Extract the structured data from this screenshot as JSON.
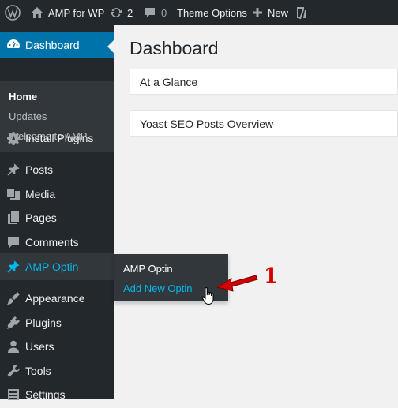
{
  "adminbar": {
    "site_name": "AMP for WP",
    "updates_count": "2",
    "comments_count": "0",
    "theme_options": "Theme Options",
    "new_label": "New"
  },
  "sidebar": {
    "dashboard": "Dashboard",
    "submenu": [
      "Home",
      "Updates",
      "Welcome to AMP"
    ],
    "items": [
      {
        "label": "Install Plugins",
        "icon": "gear-icon"
      },
      {
        "label": "Posts",
        "icon": "pin-icon"
      },
      {
        "label": "Media",
        "icon": "media-icon"
      },
      {
        "label": "Pages",
        "icon": "pages-icon"
      },
      {
        "label": "Comments",
        "icon": "comment-icon"
      },
      {
        "label": "AMP Optin",
        "icon": "pin-icon"
      },
      {
        "label": "Appearance",
        "icon": "brush-icon"
      },
      {
        "label": "Plugins",
        "icon": "plugin-icon"
      },
      {
        "label": "Users",
        "icon": "user-icon"
      },
      {
        "label": "Tools",
        "icon": "wrench-icon"
      },
      {
        "label": "Settings",
        "icon": "settings-icon"
      }
    ]
  },
  "flyout": {
    "items": [
      "AMP Optin",
      "Add New Optin"
    ]
  },
  "main": {
    "title": "Dashboard",
    "boxes": [
      "At a Glance",
      "Yoast SEO Posts Overview"
    ]
  },
  "annotation": {
    "number": "1",
    "color": "#d40000"
  },
  "colors": {
    "adminbar_bg": "#23282d",
    "sidebar_bg": "#23282d",
    "active_blue": "#0073aa",
    "link_blue": "#00b9eb"
  }
}
